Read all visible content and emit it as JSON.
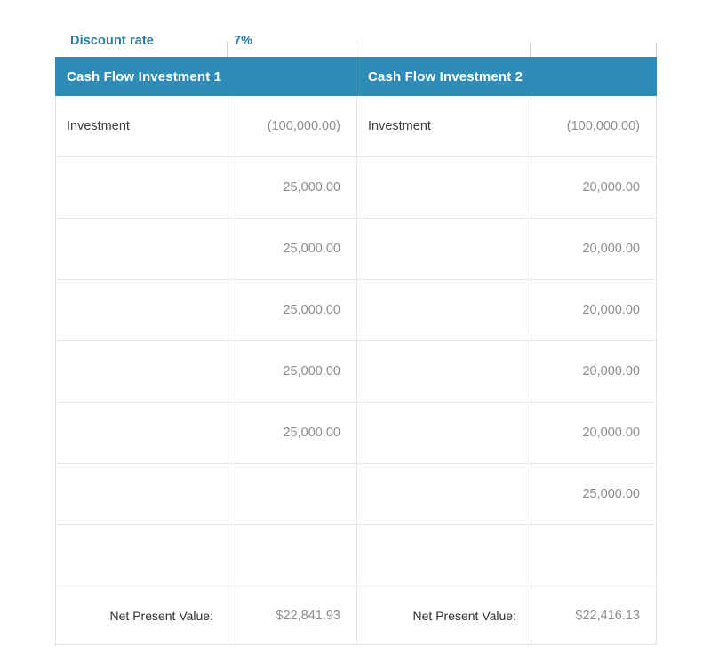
{
  "discount_rate": {
    "label": "Discount rate",
    "value": "7%"
  },
  "headers": {
    "investment_1": "Cash Flow Investment 1",
    "investment_2": "Cash Flow Investment 2"
  },
  "colors": {
    "header_background": "#2f8cb6",
    "accent_text": "#2a7ca3",
    "value_text": "#8a8d90",
    "label_text": "#3b3d3f",
    "grid_line": "#e6e8ea"
  },
  "rows": [
    {
      "label1": "Investment",
      "amount1": "(100,000.00)",
      "label2": "Investment",
      "amount2": "(100,000.00)"
    },
    {
      "label1": "",
      "amount1": "25,000.00",
      "label2": "",
      "amount2": "20,000.00"
    },
    {
      "label1": "",
      "amount1": "25,000.00",
      "label2": "",
      "amount2": "20,000.00"
    },
    {
      "label1": "",
      "amount1": "25,000.00",
      "label2": "",
      "amount2": "20,000.00"
    },
    {
      "label1": "",
      "amount1": "25,000.00",
      "label2": "",
      "amount2": "20,000.00"
    },
    {
      "label1": "",
      "amount1": "25,000.00",
      "label2": "",
      "amount2": "20,000.00"
    },
    {
      "label1": "",
      "amount1": "",
      "label2": "",
      "amount2": "25,000.00"
    },
    {
      "label1": "",
      "amount1": "",
      "label2": "",
      "amount2": ""
    }
  ],
  "totals": {
    "label1": "Net Present Value:",
    "value1": "$22,841.93",
    "label2": "Net Present Value:",
    "value2": "$22,416.13"
  }
}
